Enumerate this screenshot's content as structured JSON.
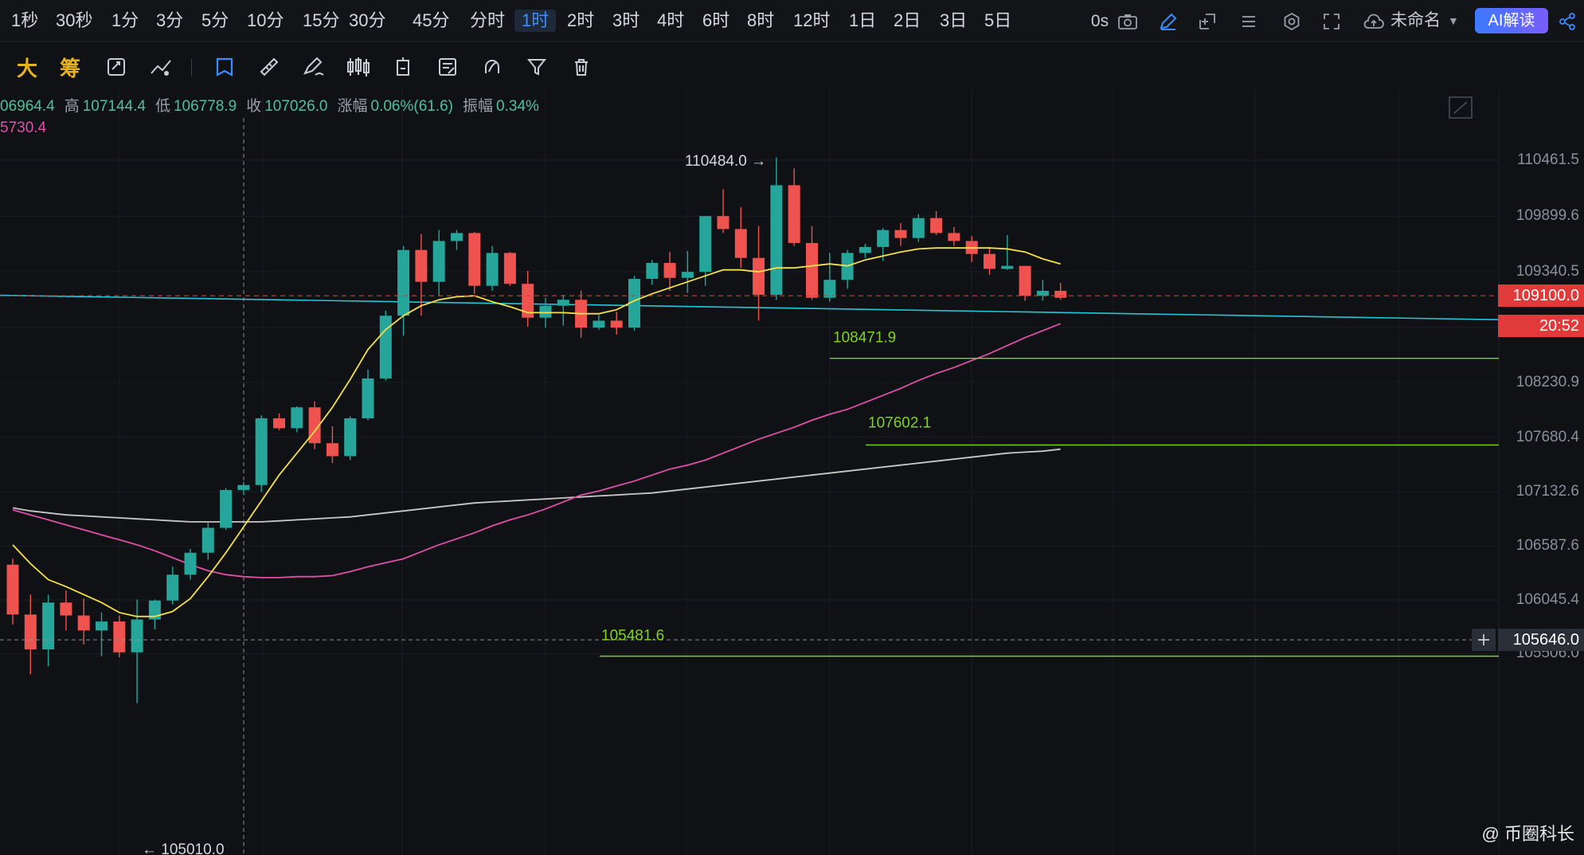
{
  "topbar": {
    "timeframes": [
      "1秒",
      "30秒",
      "1分",
      "3分",
      "5分",
      "10分",
      "15分",
      "30分",
      "45分",
      "分时",
      "1时",
      "2时",
      "3时",
      "4时",
      "6时",
      "8时",
      "12时",
      "1日",
      "2日",
      "3日",
      "5日"
    ],
    "active_timeframe": "1时",
    "countdown": "0s",
    "layout_name": "未命名",
    "ai_button": "AI解读"
  },
  "toolbar": {
    "text_tools": [
      "大",
      "筹"
    ]
  },
  "ohlc": {
    "open_value": "06964.4",
    "high_label": "高",
    "high_value": "107144.4",
    "low_label": "低",
    "low_value": "106778.9",
    "close_label": "收",
    "close_value": "107026.0",
    "change_label": "涨幅",
    "change_value": "0.06%(61.6)",
    "amp_label": "振幅",
    "amp_value": "0.34%",
    "ma_value": "5730.4"
  },
  "axis": {
    "ticks": [
      "110461.5",
      "109899.6",
      "109340.5",
      "108230.9",
      "107680.4",
      "107132.6",
      "106587.6",
      "106045.4",
      "105506.0"
    ],
    "current_price": "109100.0",
    "countdown": "20:52",
    "crosshair_price": "105646.0"
  },
  "annotations": {
    "high": "110484.0 →",
    "low": "← 105010.0",
    "level1": "108471.9",
    "level2": "107602.1",
    "level3": "105481.6"
  },
  "watermark": "@ 币圈科长",
  "colors": {
    "up": "#26a69a",
    "down": "#ef5350",
    "ma_fast": "#f5e14a",
    "ma_mid": "#e04fa8",
    "ma_slow": "#c8c8c8",
    "trendline": "#26c6da",
    "level": "#7ed321",
    "price_tag": "#e03a3a"
  },
  "chart_data": {
    "type": "candlestick",
    "series": [
      {
        "o": 106400,
        "h": 106460,
        "l": 105800,
        "c": 105900
      },
      {
        "o": 105900,
        "h": 106100,
        "l": 105300,
        "c": 105550
      },
      {
        "o": 105550,
        "h": 106100,
        "l": 105380,
        "c": 106020
      },
      {
        "o": 106020,
        "h": 106140,
        "l": 105740,
        "c": 105890
      },
      {
        "o": 105890,
        "h": 106060,
        "l": 105600,
        "c": 105740
      },
      {
        "o": 105740,
        "h": 105920,
        "l": 105480,
        "c": 105830
      },
      {
        "o": 105830,
        "h": 105890,
        "l": 105470,
        "c": 105520
      },
      {
        "o": 105520,
        "h": 106050,
        "l": 105010,
        "c": 105850
      },
      {
        "o": 105850,
        "h": 106050,
        "l": 105750,
        "c": 106040
      },
      {
        "o": 106040,
        "h": 106380,
        "l": 106000,
        "c": 106300
      },
      {
        "o": 106300,
        "h": 106560,
        "l": 106250,
        "c": 106520
      },
      {
        "o": 106520,
        "h": 106830,
        "l": 106450,
        "c": 106770
      },
      {
        "o": 106770,
        "h": 107170,
        "l": 106750,
        "c": 107150
      },
      {
        "o": 107150,
        "h": 107230,
        "l": 107100,
        "c": 107200
      },
      {
        "o": 107200,
        "h": 107900,
        "l": 107130,
        "c": 107870
      },
      {
        "o": 107870,
        "h": 107920,
        "l": 107750,
        "c": 107770
      },
      {
        "o": 107770,
        "h": 107990,
        "l": 107730,
        "c": 107980
      },
      {
        "o": 107980,
        "h": 108040,
        "l": 107560,
        "c": 107620
      },
      {
        "o": 107620,
        "h": 107790,
        "l": 107420,
        "c": 107490
      },
      {
        "o": 107490,
        "h": 107890,
        "l": 107450,
        "c": 107870
      },
      {
        "o": 107870,
        "h": 108360,
        "l": 107850,
        "c": 108270
      },
      {
        "o": 108270,
        "h": 108950,
        "l": 108250,
        "c": 108900
      },
      {
        "o": 108900,
        "h": 109600,
        "l": 108700,
        "c": 109560
      },
      {
        "o": 109560,
        "h": 109720,
        "l": 108900,
        "c": 109240
      },
      {
        "o": 109240,
        "h": 109760,
        "l": 109100,
        "c": 109650
      },
      {
        "o": 109650,
        "h": 109760,
        "l": 109560,
        "c": 109730
      },
      {
        "o": 109730,
        "h": 109740,
        "l": 109120,
        "c": 109200
      },
      {
        "o": 109200,
        "h": 109600,
        "l": 109150,
        "c": 109530
      },
      {
        "o": 109530,
        "h": 109540,
        "l": 109200,
        "c": 109220
      },
      {
        "o": 109220,
        "h": 109350,
        "l": 108790,
        "c": 108880
      },
      {
        "o": 108880,
        "h": 109080,
        "l": 108780,
        "c": 109000
      },
      {
        "o": 109000,
        "h": 109110,
        "l": 108800,
        "c": 109060
      },
      {
        "o": 109060,
        "h": 109150,
        "l": 108680,
        "c": 108780
      },
      {
        "o": 108780,
        "h": 108910,
        "l": 108760,
        "c": 108850
      },
      {
        "o": 108850,
        "h": 108940,
        "l": 108710,
        "c": 108780
      },
      {
        "o": 108780,
        "h": 109300,
        "l": 108750,
        "c": 109270
      },
      {
        "o": 109270,
        "h": 109460,
        "l": 109210,
        "c": 109430
      },
      {
        "o": 109430,
        "h": 109540,
        "l": 109150,
        "c": 109280
      },
      {
        "o": 109280,
        "h": 109550,
        "l": 109130,
        "c": 109340
      },
      {
        "o": 109340,
        "h": 109840,
        "l": 109200,
        "c": 109900
      },
      {
        "o": 109900,
        "h": 110170,
        "l": 109730,
        "c": 109770
      },
      {
        "o": 109770,
        "h": 109990,
        "l": 109380,
        "c": 109480
      },
      {
        "o": 109480,
        "h": 109800,
        "l": 108850,
        "c": 109110
      },
      {
        "o": 109110,
        "h": 110490,
        "l": 109060,
        "c": 110210
      },
      {
        "o": 110210,
        "h": 110380,
        "l": 109600,
        "c": 109630
      },
      {
        "o": 109630,
        "h": 109800,
        "l": 109060,
        "c": 109080
      },
      {
        "o": 109080,
        "h": 109530,
        "l": 109040,
        "c": 109260
      },
      {
        "o": 109260,
        "h": 109560,
        "l": 109170,
        "c": 109530
      },
      {
        "o": 109530,
        "h": 109620,
        "l": 109480,
        "c": 109590
      },
      {
        "o": 109590,
        "h": 109780,
        "l": 109450,
        "c": 109760
      },
      {
        "o": 109760,
        "h": 109830,
        "l": 109600,
        "c": 109680
      },
      {
        "o": 109680,
        "h": 109920,
        "l": 109640,
        "c": 109880
      },
      {
        "o": 109880,
        "h": 109950,
        "l": 109710,
        "c": 109730
      },
      {
        "o": 109730,
        "h": 109790,
        "l": 109600,
        "c": 109650
      },
      {
        "o": 109650,
        "h": 109700,
        "l": 109440,
        "c": 109520
      },
      {
        "o": 109520,
        "h": 109590,
        "l": 109310,
        "c": 109370
      },
      {
        "o": 109370,
        "h": 109710,
        "l": 109360,
        "c": 109400
      },
      {
        "o": 109400,
        "h": 109400,
        "l": 109050,
        "c": 109100
      },
      {
        "o": 109100,
        "h": 109260,
        "l": 109050,
        "c": 109150
      },
      {
        "o": 109150,
        "h": 109230,
        "l": 109060,
        "c": 109080
      }
    ],
    "ma_fast": [
      106600,
      106410,
      106250,
      106180,
      106100,
      106020,
      105920,
      105880,
      105880,
      105930,
      106060,
      106280,
      106520,
      106780,
      107040,
      107300,
      107520,
      107740,
      107980,
      108260,
      108560,
      108760,
      108900,
      109000,
      109060,
      109090,
      109100,
      109040,
      108990,
      108930,
      108930,
      108930,
      108920,
      108920,
      108960,
      109050,
      109120,
      109180,
      109240,
      109300,
      109360,
      109360,
      109340,
      109380,
      109380,
      109400,
      109420,
      109400,
      109460,
      109500,
      109540,
      109570,
      109580,
      109580,
      109580,
      109580,
      109570,
      109540,
      109470,
      109420
    ],
    "ma_mid": [
      106950,
      106900,
      106850,
      106800,
      106750,
      106700,
      106650,
      106600,
      106540,
      106470,
      106400,
      106340,
      106300,
      106280,
      106270,
      106270,
      106280,
      106280,
      106290,
      106330,
      106380,
      106420,
      106460,
      106530,
      106600,
      106660,
      106720,
      106790,
      106850,
      106900,
      106960,
      107030,
      107100,
      107140,
      107190,
      107240,
      107300,
      107360,
      107400,
      107450,
      107520,
      107590,
      107660,
      107720,
      107780,
      107850,
      107910,
      107960,
      108030,
      108100,
      108170,
      108250,
      108320,
      108380,
      108450,
      108520,
      108600,
      108680,
      108750,
      108820
    ],
    "ma_slow": [
      106970,
      106940,
      106920,
      106900,
      106890,
      106880,
      106870,
      106860,
      106850,
      106840,
      106830,
      106830,
      106830,
      106830,
      106830,
      106840,
      106850,
      106860,
      106870,
      106880,
      106900,
      106920,
      106940,
      106960,
      106980,
      107000,
      107020,
      107030,
      107040,
      107050,
      107060,
      107070,
      107080,
      107090,
      107100,
      107110,
      107120,
      107140,
      107160,
      107180,
      107200,
      107220,
      107240,
      107260,
      107280,
      107300,
      107320,
      107340,
      107360,
      107380,
      107400,
      107420,
      107440,
      107460,
      107480,
      107500,
      107520,
      107530,
      107540,
      107560
    ]
  }
}
